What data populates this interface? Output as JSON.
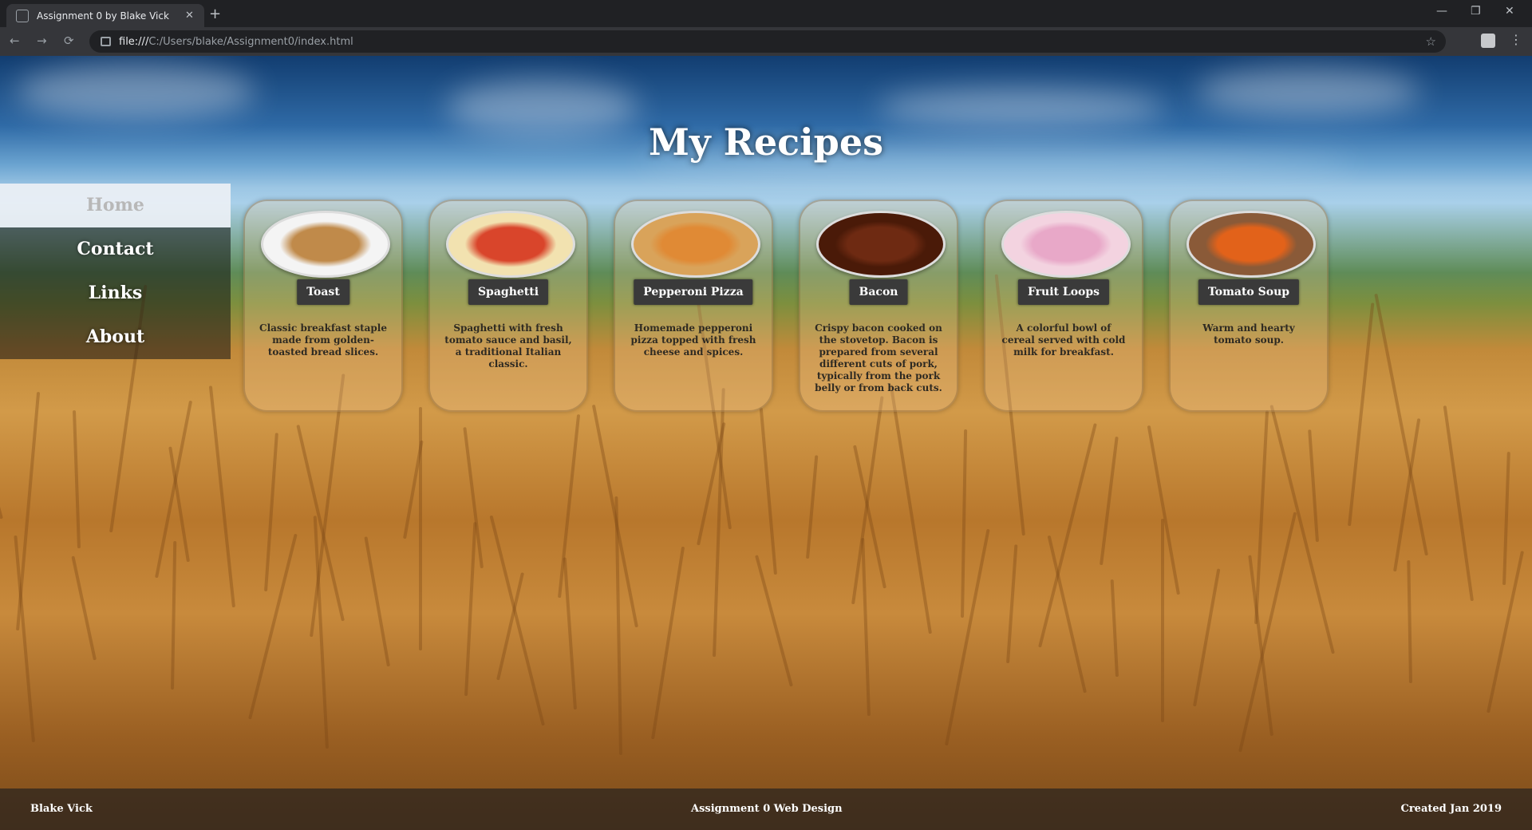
{
  "browser": {
    "tab_title": "Assignment 0 by Blake Vick",
    "tab_close": "✕",
    "new_tab": "+",
    "url_scheme": "file:///",
    "url_path": "C:/Users/blake/Assignment0/index.html",
    "back": "←",
    "forward": "→",
    "reload": "⟳",
    "star": "☆",
    "minimize": "—",
    "maximize": "❐",
    "menu": "⋮"
  },
  "site": {
    "title": "My Recipes"
  },
  "nav": {
    "items": [
      {
        "label": "Home",
        "active": true
      },
      {
        "label": "Contact",
        "active": false
      },
      {
        "label": "Links",
        "active": false
      },
      {
        "label": "About",
        "active": false
      }
    ]
  },
  "recipes": [
    {
      "name": "Toast",
      "desc": "Classic breakfast staple made from golden-toasted bread slices.",
      "dish_color": "#c08a4a",
      "plate_color": "#f4f4f4"
    },
    {
      "name": "Spaghetti",
      "desc": "Spaghetti with fresh tomato sauce and basil, a traditional Italian classic.",
      "dish_color": "#d9452b",
      "plate_color": "#f2e2b0"
    },
    {
      "name": "Pepperoni Pizza",
      "desc": "Homemade pepperoni pizza topped with fresh cheese and spices.",
      "dish_color": "#e08a35",
      "plate_color": "#d9a35a"
    },
    {
      "name": "Bacon",
      "desc": "Crispy bacon cooked on the stovetop. Bacon is prepared from several different cuts of pork, typically from the pork belly or from back cuts.",
      "dish_color": "#6e2a12",
      "plate_color": "#4a1a08"
    },
    {
      "name": "Fruit Loops",
      "desc": "A colorful bowl of cereal served with cold milk for breakfast.",
      "dish_color": "#e8a8c8",
      "plate_color": "#f3d3e0"
    },
    {
      "name": "Tomato Soup",
      "desc": "Warm and hearty tomato soup.",
      "dish_color": "#e2621a",
      "plate_color": "#8a5a38"
    }
  ],
  "footer": {
    "left": "Blake Vick",
    "center": "Assignment 0 Web Design",
    "right": "Created Jan 2019"
  }
}
